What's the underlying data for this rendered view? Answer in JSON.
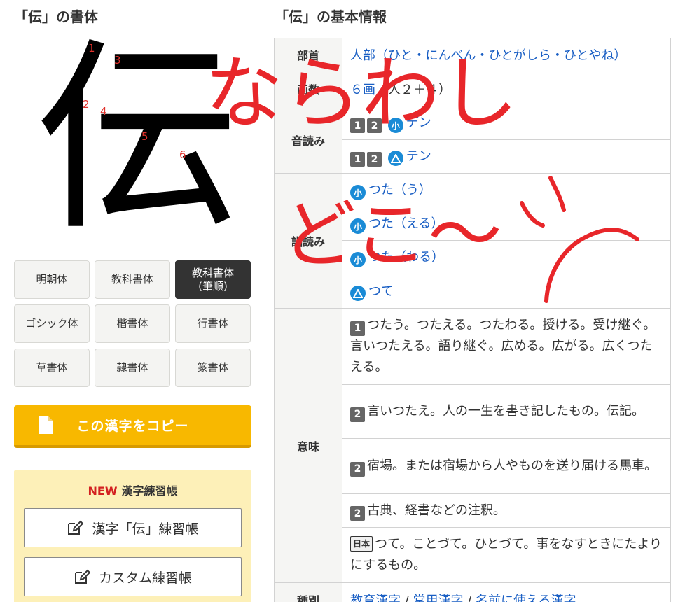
{
  "left_title": "「伝」の書体",
  "right_title": "「伝」の基本情報",
  "kanji": {
    "character": "伝",
    "stroke_numbers": [
      "1",
      "2",
      "3",
      "4",
      "5",
      "6"
    ]
  },
  "font_buttons": [
    {
      "label": "明朝体",
      "active": false
    },
    {
      "label": "教科書体",
      "active": false
    },
    {
      "label": "教科書体\n(筆順)",
      "active": true
    },
    {
      "label": "ゴシック体",
      "active": false
    },
    {
      "label": "楷書体",
      "active": false
    },
    {
      "label": "行書体",
      "active": false
    },
    {
      "label": "草書体",
      "active": false
    },
    {
      "label": "隷書体",
      "active": false
    },
    {
      "label": "篆書体",
      "active": false
    }
  ],
  "copy_button": {
    "label": "この漢字をコピー"
  },
  "practice": {
    "new_label": "NEW",
    "heading": "漢字練習帳",
    "button1": "漢字「伝」練習帳",
    "button2": "カスタム練習帳"
  },
  "table": {
    "bushu": {
      "label": "部首",
      "value": "人部（ひと・にんべん・ひとがしら・ひとやね）"
    },
    "kakusu": {
      "label": "画数",
      "link": "６画",
      "extra": "（人２＋４）"
    },
    "onyomi": {
      "label": "音読み",
      "rows": [
        {
          "badges": [
            "1",
            "2"
          ],
          "mark": "小",
          "reading": "デン"
        },
        {
          "badges": [
            "1",
            "2"
          ],
          "mark": "△",
          "reading": "テン"
        }
      ]
    },
    "kunyomi": {
      "label": "訓読み",
      "rows": [
        {
          "mark": "小",
          "reading": "つた（う）"
        },
        {
          "mark": "小",
          "reading": "つた（える）"
        },
        {
          "mark": "小",
          "reading": "つた（わる）"
        },
        {
          "mark": "△",
          "reading": "つて"
        }
      ]
    },
    "imi": {
      "label": "意味",
      "rows": [
        {
          "badge": "1",
          "text": "つたう。つたえる。つたわる。授ける。受け継ぐ。言いつたえる。語り継ぐ。広める。広がる。広くつたえる。"
        },
        {
          "badge": "2",
          "text": "言いつたえ。人の一生を書き記したもの。伝記。"
        },
        {
          "badge": "2",
          "text": "宿場。または宿場から人やものを送り届ける馬車。"
        },
        {
          "badge": "2",
          "text": "古典、経書などの注釈。"
        },
        {
          "badge": "日本",
          "text": "つて。ことづて。ひとづて。事をなすときにたよりにするもの。"
        }
      ]
    },
    "shubetsu": {
      "label": "種別",
      "links": [
        "教育漢字",
        "常用漢字",
        "名前に使える漢字"
      ],
      "separator": "/"
    }
  },
  "handwriting": {
    "line1": "ならわし",
    "line2": "どこ〜"
  },
  "colors": {
    "accent": "#f8b800",
    "link": "#1a5fc4",
    "badge_blue": "#1a8bd6",
    "stroke_number": "#e0302a",
    "scribble": "#e8262a"
  }
}
